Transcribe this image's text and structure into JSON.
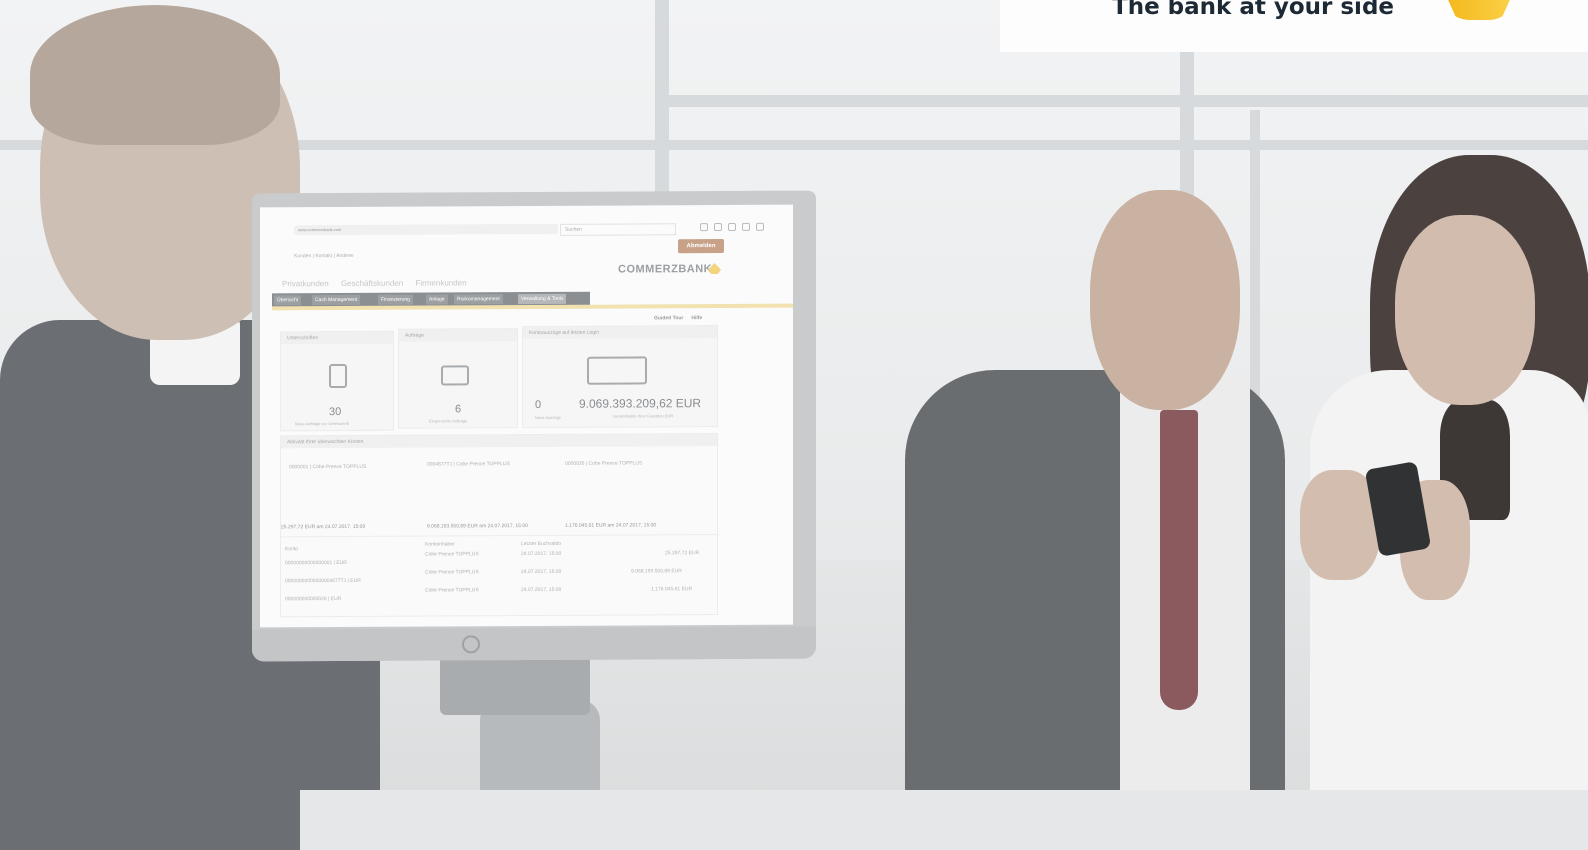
{
  "brand": {
    "tagline": "The bank at your side",
    "accent_color": "#f9c12a",
    "icon": "commerzbank-ribbon-icon"
  },
  "monitor_screen": {
    "logo_text": "COMMERZBANK",
    "logout_label": "Abmelden",
    "search_placeholder": "Suchen",
    "url_text": "www.commerzbank.com",
    "breadcrumb": "Kunden | Kontakt | Anderer",
    "segments": [
      "Privatkunden",
      "Geschäftskunden",
      "Firmenkunden"
    ],
    "tabs": [
      "Übersicht",
      "Cash Management",
      "Finanzierung",
      "Anlage",
      "Risikomanagement",
      "Verwaltung & Tools"
    ],
    "help": {
      "tour": "Guided Tour",
      "help": "Hilfe"
    },
    "cards": {
      "unterschriften": {
        "title": "Unterschriften",
        "value": "30",
        "caption": "Neue Aufträge zur Unterschrift"
      },
      "auftraege": {
        "title": "Aufträge",
        "value": "6",
        "caption": "Eingereichte Aufträge"
      },
      "kontoauszuege": {
        "title": "Kontoauszüge auf letzten Login",
        "count": "0",
        "count_caption": "Neue Auszüge",
        "amount": "9.069.393.209,62 EUR",
        "amount_caption": "Gesamtsaldo Ihrer Favoriten EUR"
      }
    },
    "favorites_title": "Aktivität Ihrer überwachten Konten",
    "accounts": [
      {
        "name": "0000001 | Cobe Prence TOPPLUS",
        "balance": "25.297,72 EUR am 24.07.2017, 15:00"
      },
      {
        "name": "0004677TJ | Cobe Prence TOPPLUS",
        "balance": "9.068.193.550,89 EUR am 24.07.2017, 15:00"
      },
      {
        "name": "0000026 | Cobe Prence TOPPLUS",
        "balance": "1.176.045,61 EUR am 24.07.2017, 15:00"
      }
    ],
    "table_headers": [
      "Konto",
      "Kontoinhaber",
      "Letzter Buchsaldo"
    ],
    "table_rows": [
      {
        "account": "00000000000000001 | EUR",
        "holder": "Cobe Prence TOPPLUS",
        "date": "24.07.2017, 15:00",
        "amount": "25.297,72 EUR"
      },
      {
        "account": "00000000000000004677TJ | EUR",
        "holder": "Cobe Prence TOPPLUS",
        "date": "24.07.2017, 15:00",
        "amount": "9.068.193.550,89 EUR"
      },
      {
        "account": "000000000000026 | EUR",
        "holder": "Cobe Prence TOPPLUS",
        "date": "24.07.2017, 15:00",
        "amount": "1.176.045,61 EUR"
      }
    ]
  }
}
